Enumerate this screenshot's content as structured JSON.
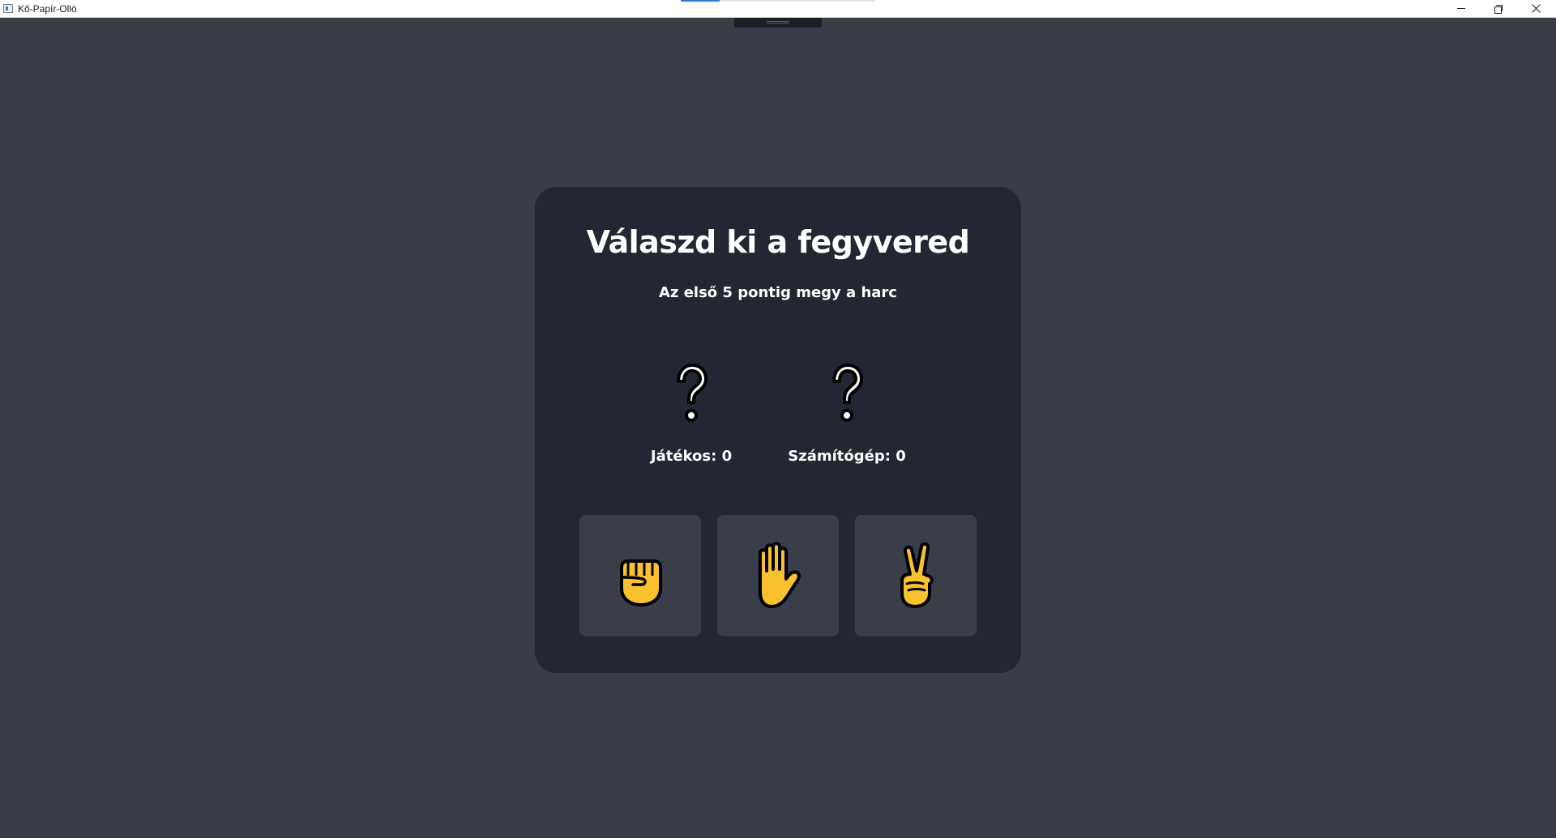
{
  "window": {
    "title": "Kő-Papír-Olló"
  },
  "game": {
    "heading": "Válaszd ki a fegyvered",
    "subheading": "Az első 5 pontig megy a harc",
    "player": {
      "label": "Játékos",
      "score": 0,
      "score_text": "Játékos: 0",
      "choice_icon": "question-mark"
    },
    "computer": {
      "label": "Számítógép",
      "score": 0,
      "score_text": "Számítógép: 0",
      "choice_icon": "question-mark"
    },
    "weapons": [
      {
        "id": "rock",
        "icon": "raised-fist-emoji"
      },
      {
        "id": "paper",
        "icon": "raised-hand-emoji"
      },
      {
        "id": "scissors",
        "icon": "victory-hand-emoji"
      }
    ]
  },
  "colors": {
    "background": "#3a3d47",
    "card": "#222733",
    "button": "#393e49",
    "text": "#ffffff",
    "emoji_yellow": "#f9c12d"
  }
}
